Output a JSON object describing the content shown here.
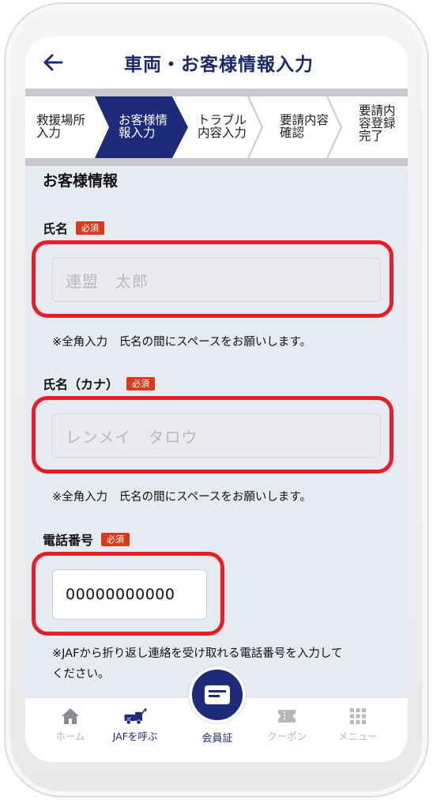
{
  "header": {
    "title": "車両・お客様情報入力"
  },
  "steps": [
    {
      "label": "救援場所\n入力",
      "active": false
    },
    {
      "label": "お客様情\n報入力",
      "active": true
    },
    {
      "label": "トラブル\n内容入力",
      "active": false
    },
    {
      "label": "要請内容\n確認",
      "active": false
    },
    {
      "label": "要請内\n容登録\n完了",
      "active": false
    }
  ],
  "form": {
    "section_title": "お客様情報",
    "required_badge": "必須",
    "name": {
      "label": "氏名",
      "placeholder": "連盟　太郎",
      "note": "※全角入力　氏名の間にスペースをお願いします。"
    },
    "name_kana": {
      "label": "氏名（カナ）",
      "placeholder": "レンメイ　タロウ",
      "note": "※全角入力　氏名の間にスペースをお願いします。"
    },
    "phone": {
      "label": "電話番号",
      "value": "00000000000",
      "note_line1": "※JAFから折り返し連絡を受け取れる電話番号を入力して",
      "note_line2": "ください。"
    }
  },
  "tabbar": {
    "home": "ホーム",
    "call_jaf": "JAFを呼ぶ",
    "member_card": "会員証",
    "coupon": "クーポン",
    "menu": "メニュー"
  },
  "colors": {
    "accent_navy": "#1d2b7a",
    "highlight_red": "#ea1c24",
    "badge_red": "#d63b1d",
    "content_bg": "#e8eaf2"
  },
  "icons": [
    "back-arrow-icon",
    "home-icon",
    "tow-truck-icon",
    "id-card-icon",
    "coupon-ticket-icon",
    "menu-grid-icon"
  ]
}
